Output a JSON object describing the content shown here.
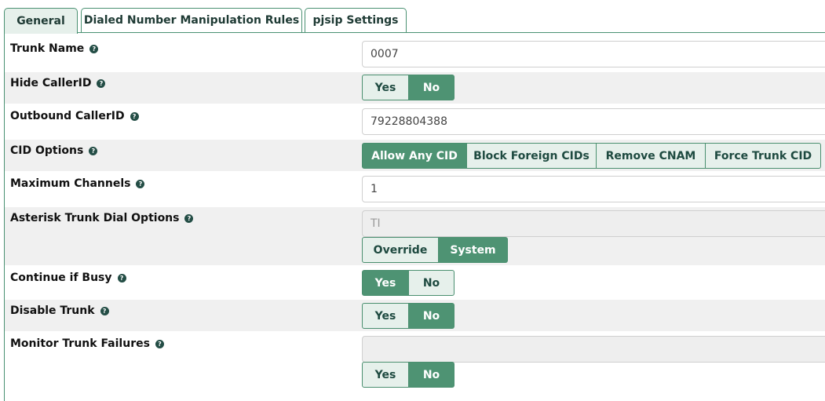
{
  "tabs": [
    {
      "label": "General",
      "active": true
    },
    {
      "label": "Dialed Number Manipulation Rules",
      "active": false
    },
    {
      "label": "pjsip Settings",
      "active": false
    }
  ],
  "help_glyph": "?",
  "fields": {
    "trunk_name": {
      "label": "Trunk Name",
      "value": "0007"
    },
    "hide_callerid": {
      "label": "Hide CallerID",
      "options": [
        "Yes",
        "No"
      ],
      "selected": "No"
    },
    "outbound_callerid": {
      "label": "Outbound CallerID",
      "value": "79228804388"
    },
    "cid_options": {
      "label": "CID Options",
      "options": [
        "Allow Any CID",
        "Block Foreign CIDs",
        "Remove CNAM",
        "Force Trunk CID"
      ],
      "selected": "Allow Any CID"
    },
    "maximum_channels": {
      "label": "Maximum Channels",
      "value": "1"
    },
    "dial_options": {
      "label": "Asterisk Trunk Dial Options",
      "value": "TI",
      "options": [
        "Override",
        "System"
      ],
      "selected": "System"
    },
    "continue_if_busy": {
      "label": "Continue if Busy",
      "options": [
        "Yes",
        "No"
      ],
      "selected": "Yes"
    },
    "disable_trunk": {
      "label": "Disable Trunk",
      "options": [
        "Yes",
        "No"
      ],
      "selected": "No"
    },
    "monitor_trunk_failures": {
      "label": "Monitor Trunk Failures",
      "value": "",
      "options": [
        "Yes",
        "No"
      ],
      "selected": "No"
    }
  },
  "colors": {
    "accent": "#4e9373",
    "accent_light": "#e6f0eb",
    "border": "#4a8f6f",
    "help_icon": "#234d45"
  }
}
